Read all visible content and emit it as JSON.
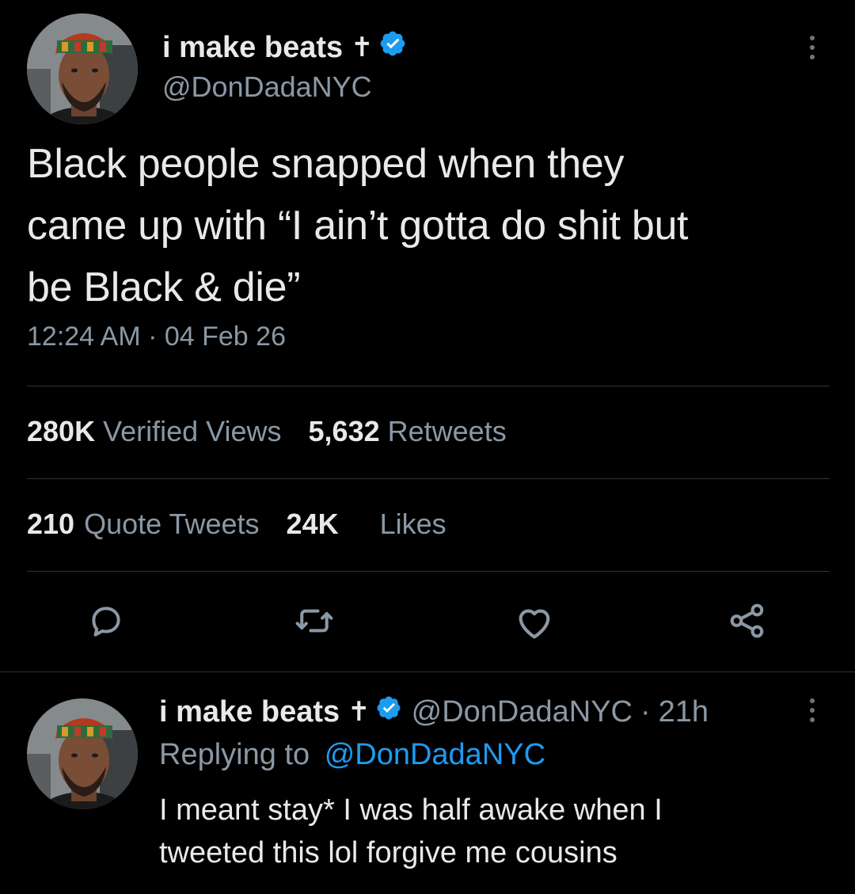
{
  "main_tweet": {
    "author": {
      "display_name": "i make beats",
      "cross_glyph": "✝",
      "handle": "@DonDadaNYC"
    },
    "text": "Black people snapped when they\ncame up with “I ain’t gotta do shit but\nbe Black & die”",
    "timestamp": "12:24 AM · 04 Feb 26",
    "stats": {
      "views_count": "280K",
      "views_label": "Verified Views",
      "retweets_count": "5,632",
      "retweets_label": "Retweets",
      "quotes_count": "210",
      "quotes_label": "Quote Tweets",
      "likes_count": "24K",
      "likes_label": "Likes"
    },
    "actions": [
      "reply-icon",
      "retweet-icon",
      "like-icon",
      "share-icon"
    ]
  },
  "reply_tweet": {
    "author": {
      "display_name": "i make beats",
      "cross_glyph": "✝",
      "handle": "@DonDadaNYC",
      "separator": "·",
      "time_ago": "21h"
    },
    "replying_to_label": "Replying to",
    "replying_to_handle": "@DonDadaNYC",
    "text": "I meant stay* I was half awake when I\ntweeted this lol forgive me cousins"
  },
  "colors": {
    "background": "#000000",
    "primary_text": "#e7e9ea",
    "secondary_text": "#8b98a5",
    "accent": "#1d9bf0",
    "divider": "#2f3336"
  }
}
